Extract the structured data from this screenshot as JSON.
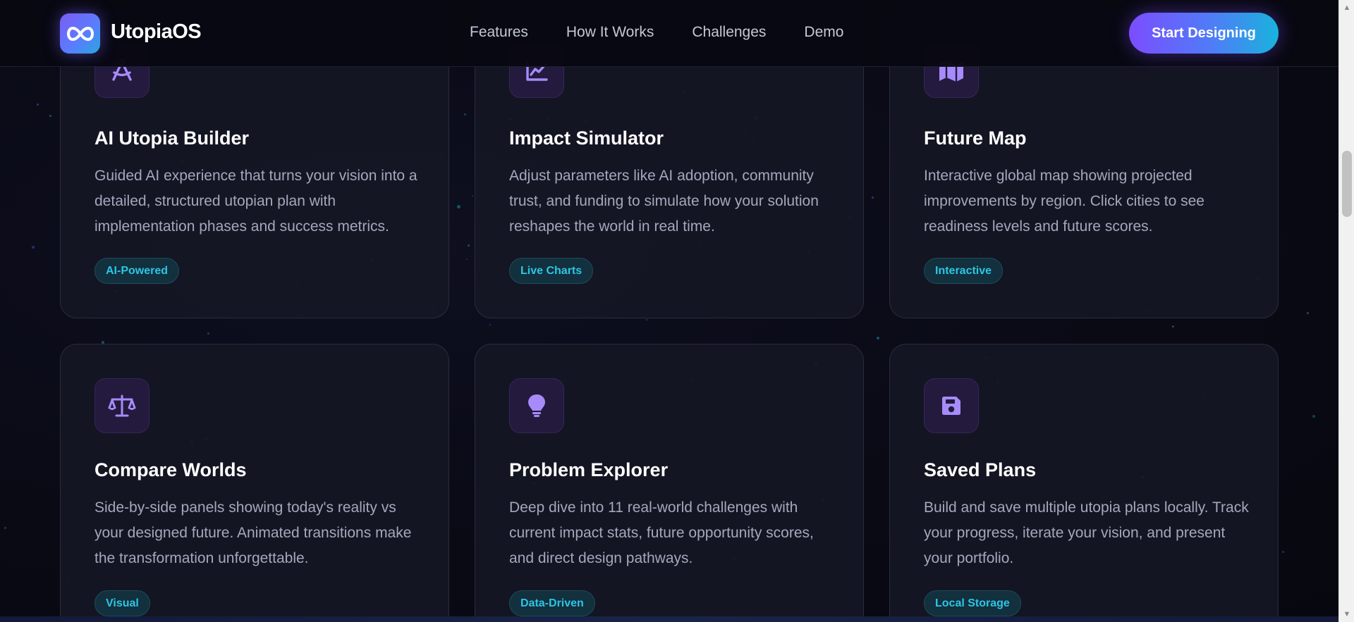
{
  "header": {
    "brand": "UtopiaOS",
    "logo_icon": "infinity-icon",
    "nav": [
      "Features",
      "How It Works",
      "Challenges",
      "Demo"
    ],
    "cta_label": "Start Designing"
  },
  "cards": [
    {
      "icon": "compass-drafting-icon",
      "title": "AI Utopia Builder",
      "description": "Guided AI experience that turns your vision into a detailed, structured utopian plan with implementation phases and success metrics.",
      "tag": "AI-Powered"
    },
    {
      "icon": "chart-line-icon",
      "title": "Impact Simulator",
      "description": "Adjust parameters like AI adoption, community trust, and funding to simulate how your solution reshapes the world in real time.",
      "tag": "Live Charts"
    },
    {
      "icon": "map-icon",
      "title": "Future Map",
      "description": "Interactive global map showing projected improvements by region. Click cities to see readiness levels and future scores.",
      "tag": "Interactive"
    },
    {
      "icon": "scale-balanced-icon",
      "title": "Compare Worlds",
      "description": "Side-by-side panels showing today's reality vs your designed future. Animated transitions make the transformation unforgettable.",
      "tag": "Visual"
    },
    {
      "icon": "lightbulb-icon",
      "title": "Problem Explorer",
      "description": "Deep dive into 11 real-world challenges with current impact stats, future opportunity scores, and direct design pathways.",
      "tag": "Data-Driven"
    },
    {
      "icon": "floppy-disk-icon",
      "title": "Saved Plans",
      "description": "Build and save multiple utopia plans locally. Track your progress, iterate your vision, and present your portfolio.",
      "tag": "Local Storage"
    }
  ],
  "colors": {
    "accent_purple": "#8b5cf6",
    "accent_cyan": "#2ec5e6",
    "background": "#0b0b16",
    "card": "#161723"
  }
}
